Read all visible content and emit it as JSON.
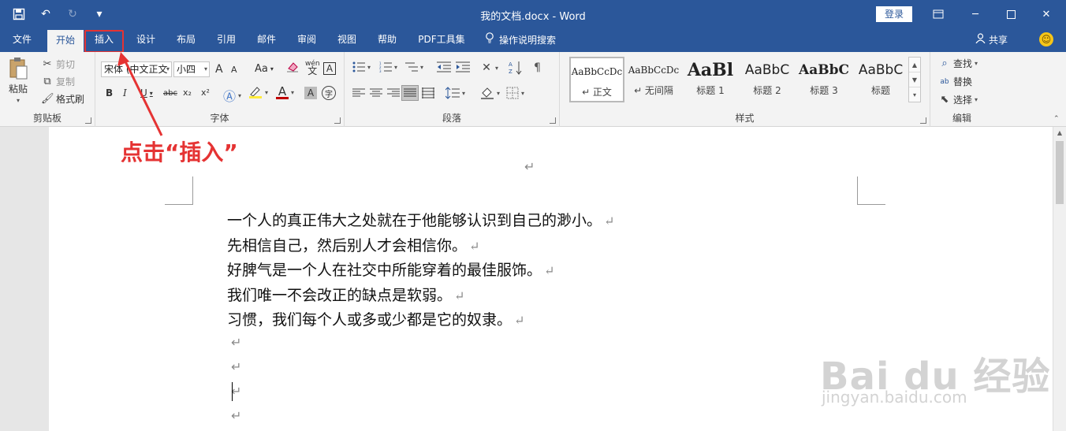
{
  "titlebar": {
    "doc_title": "我的文档.docx  -  Word",
    "login": "登录",
    "qat": {
      "save_icon": "save-icon",
      "undo_icon": "undo-icon",
      "redo_icon": "redo-icon",
      "customize_icon": "customize-qat-icon"
    }
  },
  "tabs": {
    "items": [
      "文件",
      "开始",
      "插入",
      "设计",
      "布局",
      "引用",
      "邮件",
      "审阅",
      "视图",
      "帮助",
      "PDF工具集"
    ],
    "active": "开始",
    "search": "操作说明搜索",
    "share": "共享"
  },
  "ribbon": {
    "clipboard": {
      "label": "剪贴板",
      "paste": "粘贴",
      "cut": "剪切",
      "copy": "复制",
      "format_painter": "格式刷"
    },
    "font": {
      "label": "字体",
      "font_name": "宋体 (中文正文",
      "font_size": "小四",
      "grow": "A",
      "shrink": "A",
      "case": "Aa",
      "wen": "wén",
      "border_char": "A",
      "bold": "B",
      "italic": "I",
      "underline": "U",
      "strike": "abc",
      "subscript": "x₂",
      "superscript": "x²",
      "font_color": "A",
      "shade_char": "A",
      "enclose": "字"
    },
    "paragraph": {
      "label": "段落"
    },
    "styles": {
      "label": "样式",
      "items": [
        {
          "sample": "AaBbCcDc",
          "name": "↵ 正文"
        },
        {
          "sample": "AaBbCcDc",
          "name": "↵ 无间隔"
        },
        {
          "sample": "AaBl",
          "name": "标题 1"
        },
        {
          "sample": "AaBbC",
          "name": "标题 2"
        },
        {
          "sample": "AaBbC",
          "name": "标题 3"
        },
        {
          "sample": "AaBbC",
          "name": "标题"
        }
      ]
    },
    "editing": {
      "label": "编辑",
      "find": "查找",
      "replace": "替换",
      "select": "选择"
    }
  },
  "document": {
    "para_mark": "↵",
    "lines": [
      "一个人的真正伟大之处就在于他能够认识到自己的渺小。",
      "先相信自己，然后别人才会相信你。",
      "好脾气是一个人在社交中所能穿着的最佳服饰。",
      "我们唯一不会改正的缺点是软弱。",
      "习惯，我们每个人或多或少都是它的奴隶。"
    ]
  },
  "annotation": {
    "text": "点击“插入”",
    "color": "#e53333"
  },
  "watermark": {
    "logo": "Bai du 经验",
    "url": "jingyan.baidu.com"
  },
  "colors": {
    "accent": "#2b579a",
    "ribbon_bg": "#f3f3f3",
    "highlight": "#e53333"
  }
}
